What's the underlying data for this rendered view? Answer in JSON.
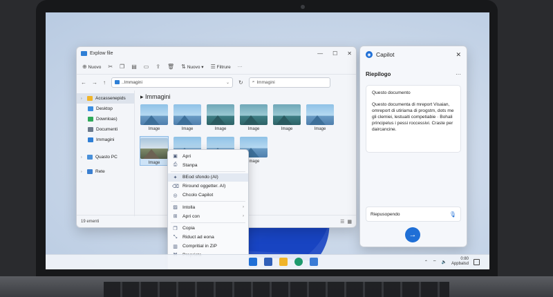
{
  "explorer": {
    "title": "Explow file",
    "window_controls": [
      "—",
      "☐",
      "✕"
    ],
    "toolbar": {
      "new_label": "Nuovo",
      "sort_label": "Nuovo",
      "filter_label": "Filtrure",
      "more_label": "···"
    },
    "address": {
      "path": "..Immagini",
      "search_placeholder": "Immagini"
    },
    "nav": [
      {
        "label": "Accassenepids",
        "active": true
      },
      {
        "label": "Desktop"
      },
      {
        "label": "Downloas)"
      },
      {
        "label": "Documenti"
      },
      {
        "label": "Immagini"
      },
      {
        "label": "Quasto PC"
      },
      {
        "label": "Rete"
      }
    ],
    "breadcrumb": "Immagini",
    "thumbnails": [
      "Image",
      "Image",
      "Image",
      "Image",
      "Image",
      "Image",
      "Image",
      "",
      "",
      "Image"
    ],
    "status": "19 ementi"
  },
  "context_menu": {
    "items": [
      "Apri",
      "Stanpa",
      "BEod sfondo (AI)",
      "Riround oggetter. AI)",
      "Chcolo Capilot",
      "Intolla",
      "Apri con",
      "Copia",
      "Riduct ad eona",
      "Compritial in ZiP",
      "Proprieta"
    ]
  },
  "copilot": {
    "title": "Capilot",
    "section_title": "Riepilogo",
    "card_heading": "Questo documento",
    "card_body": "Questo documenta di mreport Visaian, omreport di utiriama di progstm, dots me gli clemiei, lestuaiti competiabie · Bohali principelus i pessi roccessivi. Craste per daircancine.",
    "input_text": "Riepusopendo",
    "send_icon": "→"
  },
  "taskbar": {
    "time": "0:80",
    "date": "Appbalsd"
  }
}
